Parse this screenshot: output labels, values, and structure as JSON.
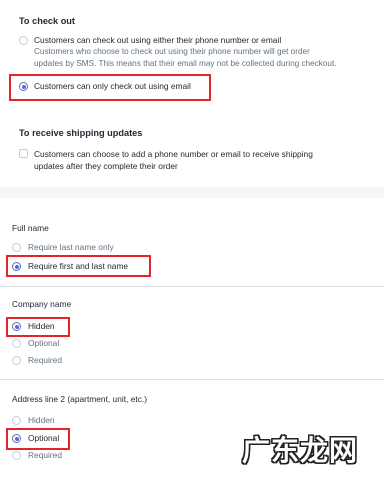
{
  "checkout": {
    "heading": "To check out",
    "option_email_or_phone": {
      "label": "Customers can check out using either their phone number or email",
      "desc_line1": "Customers who choose to check out using their phone number will get order",
      "desc_line2": "updates by SMS. This means that their email may not be collected during checkout.",
      "selected": false
    },
    "option_email_only": {
      "label": "Customers can only check out using email",
      "selected": true
    }
  },
  "shipping_updates": {
    "heading": "To receive shipping updates",
    "checkbox_line1": "Customers can choose to add a phone number or email to receive shipping",
    "checkbox_line2": "updates after they complete their order",
    "checked": false
  },
  "full_name": {
    "label": "Full name",
    "options": [
      {
        "label": "Require last name only",
        "selected": false
      },
      {
        "label": "Require first and last name",
        "selected": true
      }
    ]
  },
  "company_name": {
    "label": "Company name",
    "options": [
      {
        "label": "Hidden",
        "selected": true
      },
      {
        "label": "Optional",
        "selected": false
      },
      {
        "label": "Required",
        "selected": false
      }
    ]
  },
  "address_line2": {
    "label": "Address line 2 (apartment, unit, etc.)",
    "options": [
      {
        "label": "Hidden",
        "selected": false
      },
      {
        "label": "Optional",
        "selected": true
      },
      {
        "label": "Required",
        "selected": false
      }
    ]
  },
  "watermark": "广东龙网",
  "colors": {
    "accent": "#5c6ac4",
    "highlight": "#e3242b",
    "page_bg": "#f4f6f8",
    "card_bg": "#ffffff"
  }
}
